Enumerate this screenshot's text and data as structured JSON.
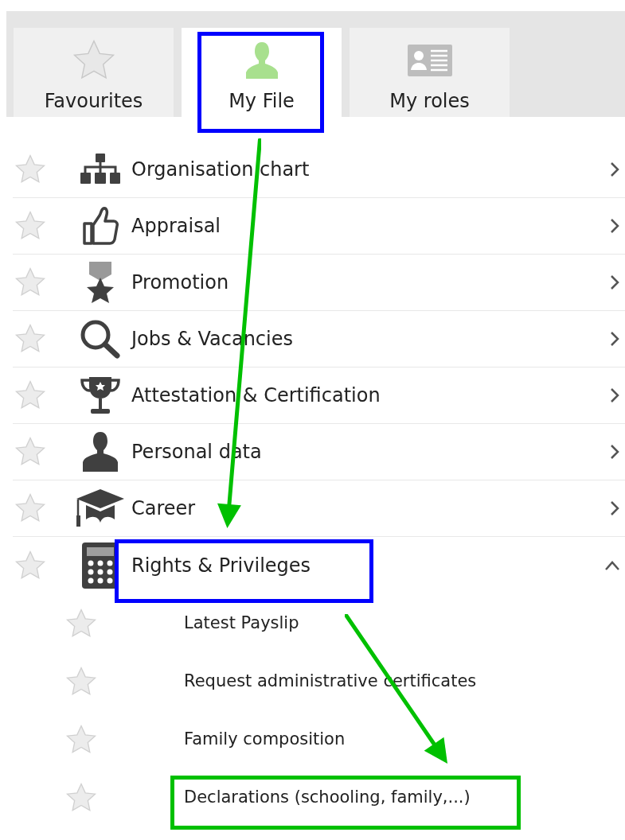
{
  "tabs": [
    {
      "label": "Favourites",
      "selected": false
    },
    {
      "label": "My File",
      "selected": true
    },
    {
      "label": "My roles",
      "selected": false
    }
  ],
  "menu": {
    "items": [
      {
        "label": "Organisation chart",
        "starred": false,
        "expanded": false
      },
      {
        "label": "Appraisal",
        "starred": false,
        "expanded": false
      },
      {
        "label": "Promotion",
        "starred": false,
        "expanded": false
      },
      {
        "label": "Jobs & Vacancies",
        "starred": false,
        "expanded": false
      },
      {
        "label": "Attestation & Certification",
        "starred": false,
        "expanded": false
      },
      {
        "label": "Personal data",
        "starred": false,
        "expanded": false
      },
      {
        "label": "Career",
        "starred": false,
        "expanded": false
      },
      {
        "label": "Rights & Privileges",
        "starred": false,
        "expanded": true,
        "children": [
          {
            "label": "Latest Payslip",
            "starred": false
          },
          {
            "label": "Request administrative certificates",
            "starred": false
          },
          {
            "label": "Family composition",
            "starred": false
          },
          {
            "label": "Declarations (schooling, family,...)",
            "starred": false
          }
        ]
      }
    ]
  },
  "annotations": [
    {
      "kind": "box",
      "color": "#0000ff"
    },
    {
      "kind": "arrow",
      "color": "#00c000"
    },
    {
      "kind": "box",
      "color": "#0000ff"
    },
    {
      "kind": "arrow",
      "color": "#00c000"
    },
    {
      "kind": "box",
      "color": "#00c000"
    }
  ]
}
